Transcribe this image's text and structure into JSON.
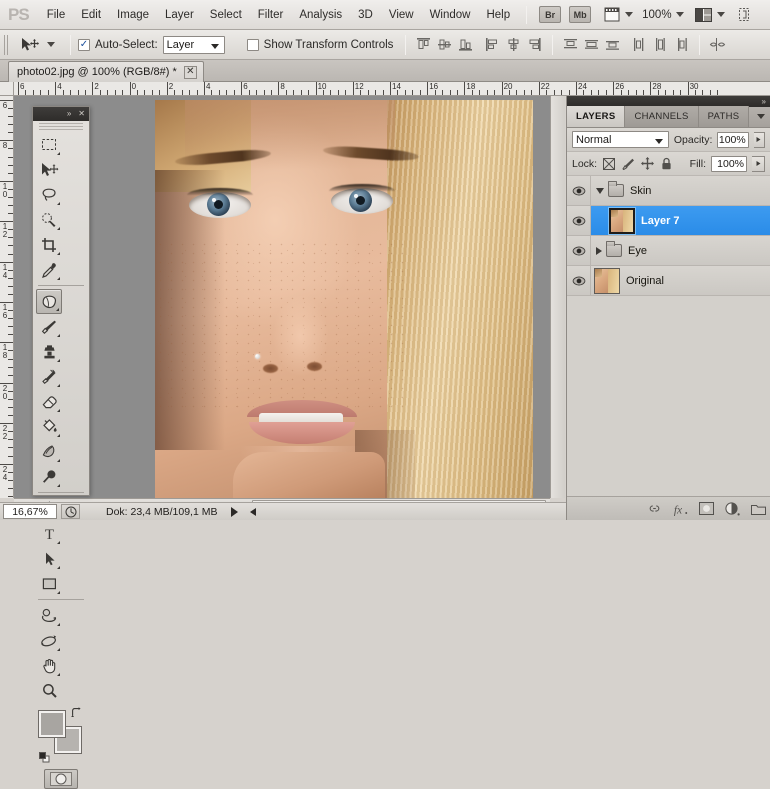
{
  "app": {
    "logo": "PS"
  },
  "menubar": {
    "items": [
      {
        "label": "File"
      },
      {
        "label": "Edit"
      },
      {
        "label": "Image"
      },
      {
        "label": "Layer"
      },
      {
        "label": "Select"
      },
      {
        "label": "Filter"
      },
      {
        "label": "Analysis"
      },
      {
        "label": "3D"
      },
      {
        "label": "View"
      },
      {
        "label": "Window"
      },
      {
        "label": "Help"
      }
    ],
    "bridge_button": "Br",
    "minibridge_button": "Mb",
    "zoom_level": "100%",
    "icons": {
      "view_extras": "view-extras-icon",
      "zoom_dropdown": "chevron-down-icon",
      "arrange_documents": "arrange-documents-icon",
      "screen_mode": "screen-mode-icon"
    }
  },
  "options_bar": {
    "tool_preset_icon": "move-tool-icon",
    "auto_select_checked": true,
    "auto_select_check_glyph": "✓",
    "auto_select_label": "Auto-Select:",
    "auto_select_value": "Layer",
    "show_transform_label": "Show Transform Controls",
    "show_transform_checked": false,
    "align_icons": [
      "align-top-edges-icon",
      "align-vertical-centers-icon",
      "align-bottom-edges-icon",
      "align-left-edges-icon",
      "align-horizontal-centers-icon",
      "align-right-edges-icon"
    ],
    "distribute_icons": [
      "distribute-top-edges-icon",
      "distribute-vertical-centers-icon",
      "distribute-bottom-edges-icon",
      "distribute-left-edges-icon",
      "distribute-horizontal-centers-icon",
      "distribute-right-edges-icon"
    ],
    "auto_align_icon": "auto-align-layers-icon"
  },
  "document_tab": {
    "title": "photo02.jpg @ 100% (RGB/8#) *",
    "close_glyph": "✕"
  },
  "rulers": {
    "horizontal_labels": [
      "6",
      "4",
      "2",
      "0",
      "2",
      "4",
      "6",
      "8",
      "10",
      "12",
      "14",
      "16",
      "18",
      "20",
      "22",
      "24",
      "26",
      "28",
      "30"
    ],
    "vertical_labels": [
      "6",
      "8",
      "10",
      "12",
      "14",
      "16",
      "18",
      "20",
      "22",
      "24"
    ],
    "unit": "cm"
  },
  "tools": {
    "header": {
      "collapse_glyph": "»",
      "close_glyph": "✕"
    },
    "items": [
      {
        "name": "rectangular-marquee-tool",
        "has_flyout": true
      },
      {
        "name": "move-tool",
        "has_flyout": false
      },
      {
        "name": "lasso-tool",
        "has_flyout": true
      },
      {
        "name": "quick-selection-tool",
        "has_flyout": true
      },
      {
        "name": "crop-tool",
        "has_flyout": true
      },
      {
        "name": "eyedropper-tool",
        "has_flyout": true
      },
      {
        "name": "patch-tool",
        "has_flyout": true,
        "active": true
      },
      {
        "name": "brush-tool",
        "has_flyout": true
      },
      {
        "name": "clone-stamp-tool",
        "has_flyout": true
      },
      {
        "name": "history-brush-tool",
        "has_flyout": true
      },
      {
        "name": "eraser-tool",
        "has_flyout": true
      },
      {
        "name": "paint-bucket-tool",
        "has_flyout": true
      },
      {
        "name": "gradient-tool",
        "has_flyout": true
      },
      {
        "name": "blur-tool",
        "has_flyout": true
      },
      {
        "name": "pen-tool",
        "has_flyout": true
      },
      {
        "name": "type-tool",
        "has_flyout": true
      },
      {
        "name": "path-selection-tool",
        "has_flyout": true
      },
      {
        "name": "rectangle-shape-tool",
        "has_flyout": true
      },
      {
        "name": "3d-rotate-tool",
        "has_flyout": true
      },
      {
        "name": "3d-orbit-tool",
        "has_flyout": true
      },
      {
        "name": "hand-tool",
        "has_flyout": true
      },
      {
        "name": "zoom-tool",
        "has_flyout": false
      }
    ],
    "swatches": {
      "foreground_color": "#a8a5a1",
      "background_color": "#b6b3af",
      "swap_icon": "swap-colors-icon",
      "default_icon": "default-colors-icon"
    },
    "quick_mask_icon": "quick-mask-mode-icon"
  },
  "panel": {
    "tabs": [
      {
        "label": "LAYERS",
        "selected": true
      },
      {
        "label": "CHANNELS",
        "selected": false
      },
      {
        "label": "PATHS",
        "selected": false
      }
    ],
    "menu_icon": "panel-menu-icon",
    "blend_mode": "Normal",
    "opacity_label": "Opacity:",
    "opacity_value": "100%",
    "lock_label": "Lock:",
    "lock_icons": [
      "lock-transparent-pixels-icon",
      "lock-image-pixels-icon",
      "lock-position-icon",
      "lock-all-icon"
    ],
    "fill_label": "Fill:",
    "fill_value": "100%",
    "layers": [
      {
        "name": "Skin",
        "type": "group",
        "expanded": true,
        "visible": true,
        "selected": false,
        "indent": 0
      },
      {
        "name": "Layer 7",
        "type": "layer",
        "visible": true,
        "selected": true,
        "indent": 1
      },
      {
        "name": "Eye",
        "type": "group",
        "expanded": false,
        "visible": true,
        "selected": false,
        "indent": 0
      },
      {
        "name": "Original",
        "type": "layer",
        "visible": true,
        "selected": false,
        "indent": 0
      }
    ],
    "selection_color": "#2f90ea",
    "footer_icons": [
      "link-layers-icon",
      "layer-style-fx-icon",
      "add-layer-mask-icon",
      "new-adjustment-layer-icon",
      "new-group-icon"
    ],
    "cursor": "hand-cursor"
  },
  "status_bar": {
    "zoom_value": "16,67%",
    "timing_icon": "timing-icon",
    "doc_info": "Dok: 23,4 MB/109,1 MB",
    "play_icon": "status-play-icon",
    "prev_icon": "status-prev-icon"
  },
  "canvas": {
    "image_name": "photo02.jpg",
    "background_color": "#8c8c8c"
  }
}
